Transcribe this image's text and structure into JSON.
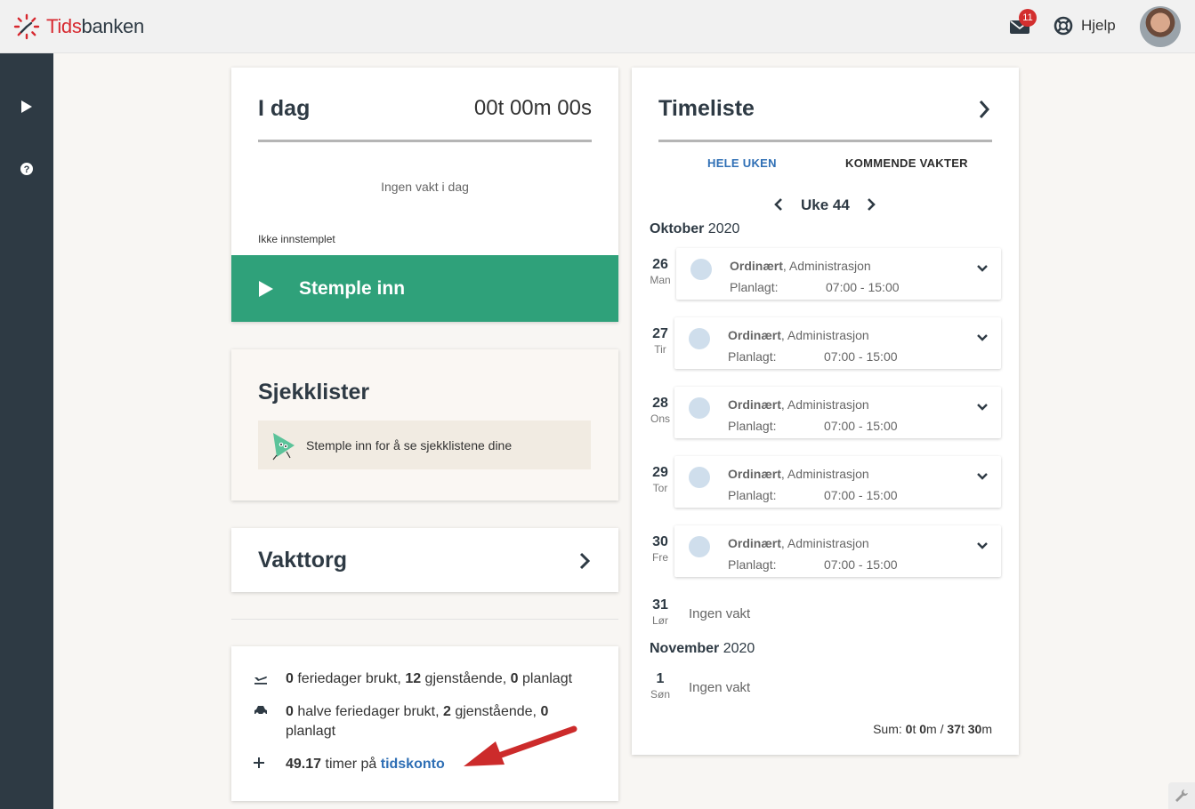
{
  "app": {
    "brand_red": "Tids",
    "brand_rest": "banken",
    "mail_count": "11",
    "help_label": "Hjelp"
  },
  "today": {
    "title": "I dag",
    "timer": "00t 00m 00s",
    "no_shift": "Ingen vakt i dag",
    "status": "Ikke innstemplet",
    "stamp_button": "Stemple inn"
  },
  "checklists": {
    "title": "Sjekklister",
    "message": "Stemple inn for å se sjekklistene dine"
  },
  "market": {
    "title": "Vakttorg"
  },
  "balances": {
    "vacation": {
      "used": "0",
      "used_text": " feriedager brukt, ",
      "remaining": "12",
      "remaining_text": " gjenstående, ",
      "planned": "0",
      "planned_text": " planlagt"
    },
    "half": {
      "used": "0",
      "used_text": " halve feriedager brukt, ",
      "remaining": "2",
      "remaining_text": " gjenstående, ",
      "planned": "0",
      "planned_text": "planlagt"
    },
    "account": {
      "hours": "49.17",
      "text": " timer på ",
      "link": "tidskonto"
    }
  },
  "timesheet": {
    "title": "Timeliste",
    "tab_week": "HELE UKEN",
    "tab_upcoming": "KOMMENDE VAKTER",
    "week_label": "Uke 44",
    "month1_name": "Oktober",
    "month1_year": " 2020",
    "month2_name": "November",
    "month2_year": " 2020",
    "days": [
      {
        "num": "26",
        "wd": "Man",
        "type": "Ordinært",
        "dept": ", Administrasjon",
        "planned_label": "Planlagt:",
        "time": "07:00 - 15:00"
      },
      {
        "num": "27",
        "wd": "Tir",
        "type": "Ordinært",
        "dept": ", Administrasjon",
        "planned_label": "Planlagt:",
        "time": "07:00 - 15:00"
      },
      {
        "num": "28",
        "wd": "Ons",
        "type": "Ordinært",
        "dept": ", Administrasjon",
        "planned_label": "Planlagt:",
        "time": "07:00 - 15:00"
      },
      {
        "num": "29",
        "wd": "Tor",
        "type": "Ordinært",
        "dept": ", Administrasjon",
        "planned_label": "Planlagt:",
        "time": "07:00 - 15:00"
      },
      {
        "num": "30",
        "wd": "Fre",
        "type": "Ordinært",
        "dept": ", Administrasjon",
        "planned_label": "Planlagt:",
        "time": "07:00 - 15:00"
      }
    ],
    "empty_days": [
      {
        "num": "31",
        "wd": "Lør",
        "text": "Ingen vakt"
      },
      {
        "num": "1",
        "wd": "Søn",
        "text": "Ingen vakt"
      }
    ],
    "sum": {
      "label": "Sum: ",
      "h1": "0",
      "t1": "t ",
      "m1": "0",
      "t2": "m / ",
      "h2": "37",
      "t3": "t ",
      "m2": "30",
      "t4": "m"
    }
  },
  "colors": {
    "sidebar": "#2e3a44",
    "stamp": "#2fa17a",
    "link": "#2f6fb5",
    "badge": "#d32f2f",
    "arrow": "#cc2b2b"
  },
  "icons": [
    "logo-icon",
    "mail-icon",
    "lifebuoy-icon",
    "play-icon",
    "question-icon",
    "chevron-right-icon",
    "chevron-left-icon",
    "chevron-down-icon",
    "plane-icon",
    "car-icon",
    "plus-icon",
    "wrench-icon",
    "arrow-annotation"
  ]
}
